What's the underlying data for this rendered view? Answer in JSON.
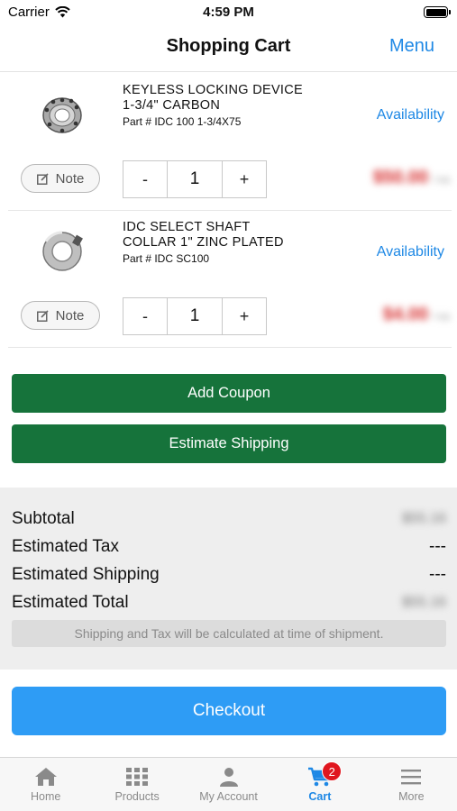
{
  "status_bar": {
    "carrier": "Carrier",
    "time": "4:59 PM"
  },
  "nav": {
    "title": "Shopping Cart",
    "menu_label": "Menu"
  },
  "items": [
    {
      "name": "KEYLESS LOCKING DEVICE 1-3/4\" CARBON",
      "part": "Part # IDC 100 1-3/4X75",
      "availability_label": "Availability",
      "note_label": "Note",
      "qty": "1",
      "price": "$50.00",
      "price_unit": "/ ea",
      "minus_label": "-",
      "plus_label": "+"
    },
    {
      "name": "IDC SELECT SHAFT COLLAR 1\" ZINC PLATED",
      "part": "Part # IDC SC100",
      "availability_label": "Availability",
      "note_label": "Note",
      "qty": "1",
      "price": "$4.00",
      "price_unit": "/ ea",
      "minus_label": "-",
      "plus_label": "+"
    }
  ],
  "buttons": {
    "add_coupon": "Add Coupon",
    "estimate_shipping": "Estimate Shipping",
    "checkout": "Checkout"
  },
  "summary": {
    "subtotal_label": "Subtotal",
    "subtotal_value": "$55.16",
    "tax_label": "Estimated Tax",
    "tax_value": "---",
    "shipping_label": "Estimated Shipping",
    "shipping_value": "---",
    "total_label": "Estimated Total",
    "total_value": "$55.16",
    "note": "Shipping and Tax will be calculated at time of shipment."
  },
  "tabs": [
    {
      "label": "Home",
      "icon": "home-icon"
    },
    {
      "label": "Products",
      "icon": "grid-icon"
    },
    {
      "label": "My Account",
      "icon": "person-icon"
    },
    {
      "label": "Cart",
      "icon": "cart-icon",
      "badge": "2",
      "active": true
    },
    {
      "label": "More",
      "icon": "menu-icon"
    }
  ],
  "colors": {
    "accent_blue": "#1e88e5",
    "green_button": "#16733b",
    "checkout_blue": "#2e9cf5",
    "badge_red": "#e0161f"
  }
}
